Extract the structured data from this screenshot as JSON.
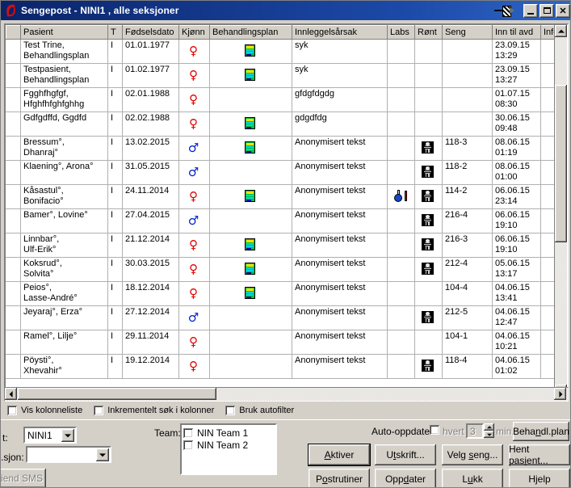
{
  "window": {
    "title": "Sengepost - NINI1 , alle seksjoner",
    "icon": "app-swoosh-icon",
    "pin_icon": "pushpin-icon",
    "minimize_label": "",
    "maximize_label": "",
    "close_label": "✕",
    "titlebar_color": "#0a246a"
  },
  "grid": {
    "columns": [
      {
        "key": "pasient",
        "label": "Pasient"
      },
      {
        "key": "t",
        "label": "T"
      },
      {
        "key": "fodselsdato",
        "label": "Fødselsdato"
      },
      {
        "key": "kjonn",
        "label": "Kjønn"
      },
      {
        "key": "behandlingsplan",
        "label": "Behandlingsplan"
      },
      {
        "key": "innleggelsesarsak",
        "label": "Innleggelsårsak"
      },
      {
        "key": "labs",
        "label": "Labs"
      },
      {
        "key": "ront",
        "label": "Rønt"
      },
      {
        "key": "seng",
        "label": "Seng"
      },
      {
        "key": "inn_til_avd",
        "label": "Inn til avd"
      },
      {
        "key": "info",
        "label": "Info"
      }
    ],
    "rows": [
      {
        "pasient": "Test Trine, Behandlingsplan",
        "t": "I",
        "fodselsdato": "01.01.1977",
        "kjonn": "female",
        "behandlingsplan": true,
        "innleggelsesarsak": "syk",
        "labs": false,
        "ront": false,
        "seng": "",
        "inn_til_avd_date": "23.09.15",
        "inn_til_avd_time": "13:29",
        "info": ""
      },
      {
        "pasient": "Testpasient, Behandlingsplan",
        "t": "I",
        "fodselsdato": "01.02.1977",
        "kjonn": "female",
        "behandlingsplan": true,
        "innleggelsesarsak": "syk",
        "labs": false,
        "ront": false,
        "seng": "",
        "inn_til_avd_date": "23.09.15",
        "inn_til_avd_time": "13:27",
        "info": ""
      },
      {
        "pasient": "Fgghfhgfgf, Hfghfhfghfghhg",
        "t": "I",
        "fodselsdato": "02.01.1988",
        "kjonn": "female",
        "behandlingsplan": false,
        "innleggelsesarsak": "gfdgfdgdg",
        "labs": false,
        "ront": false,
        "seng": "",
        "inn_til_avd_date": "01.07.15",
        "inn_til_avd_time": "08:30",
        "info": ""
      },
      {
        "pasient": "Gdfgdffd, Ggdfd",
        "t": "I",
        "fodselsdato": "02.02.1988",
        "kjonn": "female",
        "behandlingsplan": true,
        "innleggelsesarsak": "gdgdfdg",
        "labs": false,
        "ront": false,
        "seng": "",
        "inn_til_avd_date": "30.06.15",
        "inn_til_avd_time": "09:48",
        "info": ""
      },
      {
        "pasient": "Bressum°, Dhanraj°",
        "t": "I",
        "fodselsdato": "13.02.2015",
        "kjonn": "male",
        "behandlingsplan": true,
        "innleggelsesarsak": "Anonymisert tekst",
        "labs": false,
        "ront": true,
        "seng": "118-3",
        "inn_til_avd_date": "08.06.15",
        "inn_til_avd_time": "01:19",
        "info": ""
      },
      {
        "pasient": "Klaening°, Arona°",
        "t": "I",
        "fodselsdato": "31.05.2015",
        "kjonn": "male",
        "behandlingsplan": false,
        "innleggelsesarsak": "Anonymisert tekst",
        "labs": false,
        "ront": true,
        "seng": "118-2",
        "inn_til_avd_date": "08.06.15",
        "inn_til_avd_time": "01:00",
        "info": ""
      },
      {
        "pasient": "Kåsastul°, Bonifacio°",
        "t": "I",
        "fodselsdato": "24.11.2014",
        "kjonn": "female",
        "behandlingsplan": true,
        "innleggelsesarsak": "Anonymisert tekst",
        "labs": true,
        "ront": true,
        "seng": "114-2",
        "inn_til_avd_date": "06.06.15",
        "inn_til_avd_time": "23:14",
        "info": ""
      },
      {
        "pasient": "Bamer°, Lovine°",
        "t": "I",
        "fodselsdato": "27.04.2015",
        "kjonn": "male",
        "behandlingsplan": false,
        "innleggelsesarsak": "Anonymisert tekst",
        "labs": false,
        "ront": true,
        "seng": "216-4",
        "inn_til_avd_date": "06.06.15",
        "inn_til_avd_time": "19:10",
        "info": ""
      },
      {
        "pasient": "Linnbar°, Ulf-Erik°",
        "t": "I",
        "fodselsdato": "21.12.2014",
        "kjonn": "female",
        "behandlingsplan": true,
        "innleggelsesarsak": "Anonymisert tekst",
        "labs": false,
        "ront": true,
        "seng": "216-3",
        "inn_til_avd_date": "06.06.15",
        "inn_til_avd_time": "19:10",
        "info": ""
      },
      {
        "pasient": "Koksrud°, Solvita°",
        "t": "I",
        "fodselsdato": "30.03.2015",
        "kjonn": "female",
        "behandlingsplan": true,
        "innleggelsesarsak": "Anonymisert tekst",
        "labs": false,
        "ront": true,
        "seng": "212-4",
        "inn_til_avd_date": "05.06.15",
        "inn_til_avd_time": "13:17",
        "info": ""
      },
      {
        "pasient": "Peios°, Lasse-André°",
        "t": "I",
        "fodselsdato": "18.12.2014",
        "kjonn": "female",
        "behandlingsplan": true,
        "innleggelsesarsak": "Anonymisert tekst",
        "labs": false,
        "ront": false,
        "seng": "104-4",
        "inn_til_avd_date": "04.06.15",
        "inn_til_avd_time": "13:41",
        "info": ""
      },
      {
        "pasient": "Jeyaraj°, Erza°",
        "t": "I",
        "fodselsdato": "27.12.2014",
        "kjonn": "male",
        "behandlingsplan": false,
        "innleggelsesarsak": "Anonymisert tekst",
        "labs": false,
        "ront": true,
        "seng": "212-5",
        "inn_til_avd_date": "04.06.15",
        "inn_til_avd_time": "12:47",
        "info": ""
      },
      {
        "pasient": "Ramel°, Lilje°",
        "t": "I",
        "fodselsdato": "29.11.2014",
        "kjonn": "female",
        "behandlingsplan": false,
        "innleggelsesarsak": "Anonymisert tekst",
        "labs": false,
        "ront": false,
        "seng": "104-1",
        "inn_til_avd_date": "04.06.15",
        "inn_til_avd_time": "10:21",
        "info": ""
      },
      {
        "pasient": "Pöysti°, Xhevahir°",
        "t": "I",
        "fodselsdato": "19.12.2014",
        "kjonn": "female",
        "behandlingsplan": false,
        "innleggelsesarsak": "Anonymisert tekst",
        "labs": false,
        "ront": true,
        "seng": "118-4",
        "inn_til_avd_date": "04.06.15",
        "inn_til_avd_time": "01:02",
        "info": ""
      }
    ]
  },
  "options": {
    "vis_kolonneliste": "Vis kolonneliste",
    "inkrementelt_sok": "Inkrementelt søk i kolonner",
    "bruk_autofilter": "Bruk autofilter",
    "vis_kolonneliste_checked": false,
    "inkrementelt_sok_checked": false,
    "bruk_autofilter_checked": false
  },
  "bottom": {
    "post_label": "t:",
    "post_value": "NINI1",
    "seksjon_label": ".sjon:",
    "seksjon_value": "",
    "send_sms_label": "iend SMS",
    "team_label": "Team:",
    "team_items": [
      {
        "label": "NIN Team 1",
        "checked": false
      },
      {
        "label": "NIN Team 2",
        "checked": false
      }
    ],
    "auto_oppdater_label": "Auto-oppdater",
    "auto_oppdater_checked": false,
    "hvert_label": "hvert",
    "interval_value": "3",
    "min_label": "min.",
    "buttons": {
      "behandl_plan": {
        "pre": "Beha",
        "accel": "n",
        "post": "dl.plan"
      },
      "aktiver": {
        "pre": "",
        "accel": "A",
        "post": "ktiver"
      },
      "utskrift": {
        "pre": "U",
        "accel": "t",
        "post": "skrift..."
      },
      "velg_seng": {
        "pre": "Velg ",
        "accel": "s",
        "post": "eng..."
      },
      "hent_pasient": {
        "pre": "Hent pas",
        "accel": "i",
        "post": "ent..."
      },
      "postrutiner": {
        "pre": "P",
        "accel": "o",
        "post": "strutiner"
      },
      "oppdater": {
        "pre": "Opp",
        "accel": "d",
        "post": "ater"
      },
      "lukk": {
        "pre": "L",
        "accel": "u",
        "post": "kk"
      },
      "hjelp": {
        "pre": "H",
        "accel": "j",
        "post": "elp"
      }
    }
  }
}
